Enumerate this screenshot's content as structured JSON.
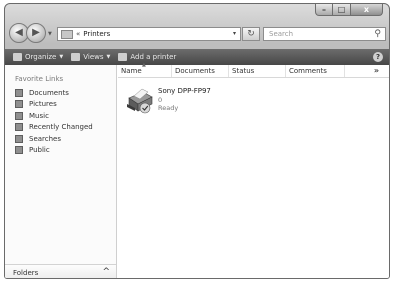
{
  "window": {
    "caption": {
      "minimize": "–",
      "maximize": "□",
      "close": "x"
    }
  },
  "address": {
    "separator": "«",
    "path": "Printers",
    "dropdown": "▾"
  },
  "search": {
    "placeholder": "Search"
  },
  "toolbar": {
    "organize": "Organize",
    "views": "Views",
    "add_printer": "Add a printer",
    "help": "?"
  },
  "nav_pane": {
    "title": "Favorite Links",
    "items": [
      {
        "label": "Documents",
        "icon": "documents-icon"
      },
      {
        "label": "Pictures",
        "icon": "pictures-icon"
      },
      {
        "label": "Music",
        "icon": "music-icon"
      },
      {
        "label": "Recently Changed",
        "icon": "recently-changed-icon"
      },
      {
        "label": "Searches",
        "icon": "searches-icon"
      },
      {
        "label": "Public",
        "icon": "public-icon"
      }
    ],
    "folders_label": "Folders",
    "folders_chevron": "^"
  },
  "columns": {
    "name": "Name",
    "documents": "Documents",
    "status": "Status",
    "comments": "Comments",
    "more": "»"
  },
  "printers": [
    {
      "name": "Sony DPP-FP97",
      "documents": "0",
      "status": "Ready"
    }
  ]
}
